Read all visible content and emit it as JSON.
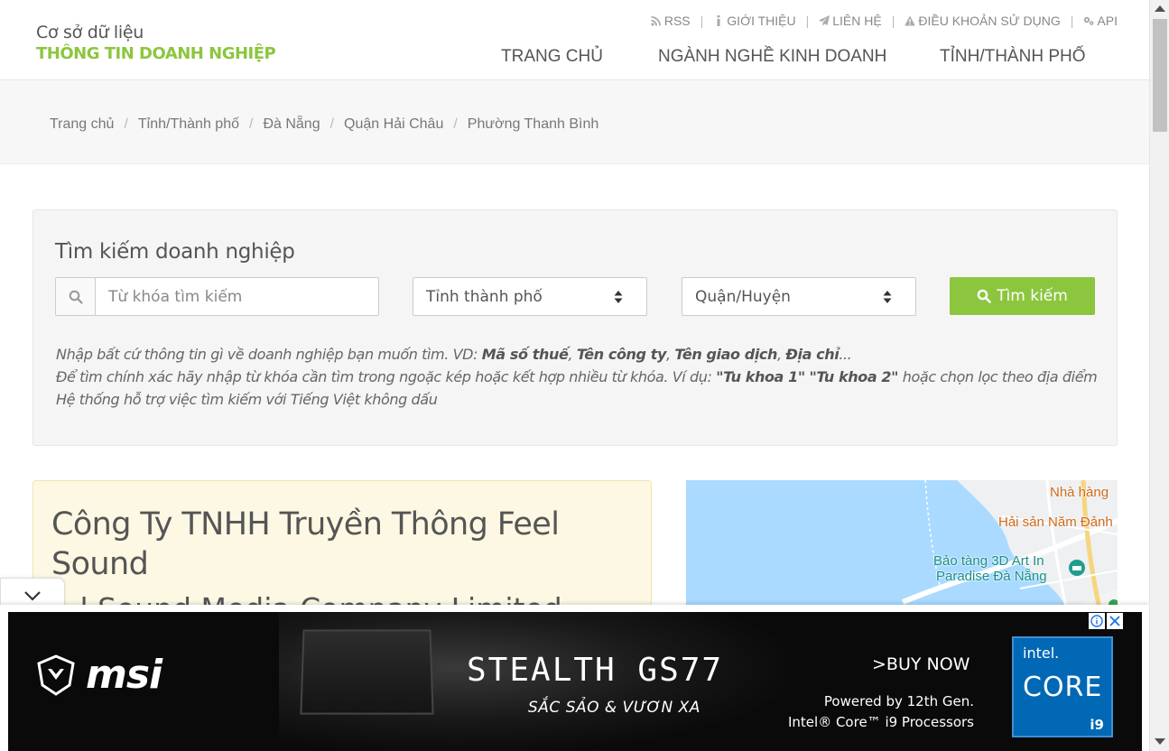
{
  "logo": {
    "line1": "Cơ sở dữ liệu",
    "line2": "THÔNG TIN DOANH NGHIỆP"
  },
  "toplinks": [
    {
      "icon": "rss-icon",
      "label": "RSS"
    },
    {
      "icon": "info-icon",
      "label": "GIỚI THIỆU"
    },
    {
      "icon": "send-icon",
      "label": "LIÊN HỆ"
    },
    {
      "icon": "warning-icon",
      "label": "ĐIỀU KHOẢN SỬ DỤNG"
    },
    {
      "icon": "gears-icon",
      "label": "API"
    }
  ],
  "nav": [
    "TRANG CHỦ",
    "NGÀNH NGHỀ KINH DOANH",
    "TỈNH/THÀNH PHỐ"
  ],
  "breadcrumb": [
    "Trang chủ",
    "Tỉnh/Thành phố",
    "Đà Nẵng",
    "Quận Hải Châu",
    "Phường Thanh Bình"
  ],
  "search": {
    "title": "Tìm kiếm doanh nghiệp",
    "keyword_placeholder": "Từ khóa tìm kiếm",
    "keyword_value": "",
    "province_selected": "Tỉnh thành phố",
    "district_selected": "Quận/Huyện",
    "button_label": "Tìm kiếm",
    "help": {
      "line1_prefix": "Nhập bất cứ thông tin gì về doanh nghiệp bạn muốn tìm. VD: ",
      "line1_terms": [
        "Mã số thuế",
        "Tên công ty",
        "Tên giao dịch",
        "Địa chỉ"
      ],
      "line1_sep": ", ",
      "line1_suffix": "...",
      "line2_prefix": "Để tìm chính xác hãy nhập từ khóa cần tìm trong ngoặc kép hoặc kết hợp nhiều từ khóa. Ví dụ: ",
      "line2_example1": "\"Tu khoa 1\"",
      "line2_example2": "\"Tu khoa 2\"",
      "line2_suffix": " hoặc chọn lọc theo địa điểm",
      "line3": "Hệ thống hỗ trợ việc tìm kiếm với Tiếng Việt không dấu"
    }
  },
  "company": {
    "name": "Công Ty TNHH Truyền Thông Feel Sound",
    "english_name_partial": "...l Sound Media Company Limited"
  },
  "map": {
    "labels": [
      "Nhà hàng",
      "Hải sản Năm Đảnh",
      "Bảo tàng 3D Art In",
      "Paradise Đà Nẵng"
    ]
  },
  "ad": {
    "brand": "msi",
    "model": "STEALTH GS77",
    "tagline": "SẮC SẢO & VƯƠN XA",
    "cta": ">BUY NOW",
    "powered_line1": "Powered by 12th Gen.",
    "powered_line2": "Intel® Core™ i9 Processors",
    "intel_label": "intel.",
    "intel_core": "CORE",
    "intel_tier": "i9"
  },
  "colors": {
    "accent": "#8cc63f",
    "card_bg": "#fcf8e3",
    "panel_bg": "#f5f5f5"
  }
}
